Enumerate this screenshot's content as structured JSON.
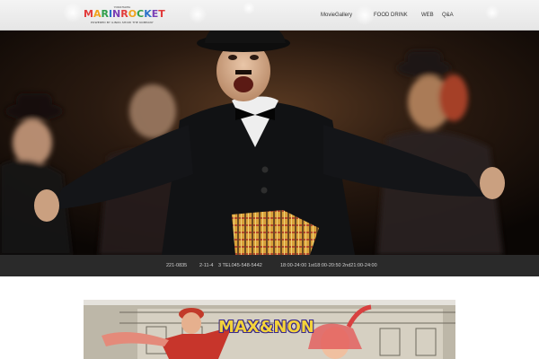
{
  "header": {
    "logo": {
      "top_text": "YOKOHAMA",
      "wordmark": "MARINROCKET",
      "bottom_text": "POWERED BY GINZA SHOW THE KOMPANY"
    },
    "nav": [
      {
        "label": "MovieGallery"
      },
      {
        "label": "FOOD DRINK"
      },
      {
        "label": "WEB"
      },
      {
        "label": "Q&A"
      }
    ]
  },
  "info": {
    "postal": "221-0835",
    "address": "2-11-4",
    "tel": "3  TEL045-548-5442",
    "hours": "18:00-24:00 1st18:00-20:50 2nd21:00-24:00"
  },
  "banner": {
    "title": "MAX&NON"
  },
  "colors": {
    "header_bg": "#ececec",
    "infobar_bg": "#2a2a2a",
    "logo_colors": [
      "#e23b3b",
      "#f0a21c",
      "#2e9e49",
      "#2a72c9",
      "#7a3fb5"
    ]
  }
}
